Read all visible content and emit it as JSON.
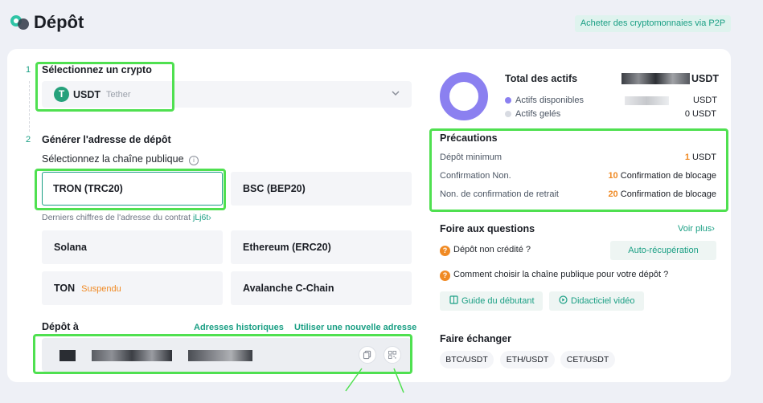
{
  "header": {
    "title": "Dépôt",
    "p2p_button": "Acheter des cryptomonnaies via P2P"
  },
  "step1": {
    "number": "1",
    "title": "Sélectionnez un crypto",
    "selected_symbol": "USDT",
    "selected_name": "Tether",
    "coin_icon": "T"
  },
  "step2": {
    "number": "2",
    "title": "Générer l'adresse de dépôt",
    "chain_label": "Sélectionnez la chaîne publique",
    "info_icon": "i",
    "chains": [
      {
        "name": "TRON (TRC20)",
        "status": ""
      },
      {
        "name": "BSC (BEP20)",
        "status": ""
      },
      {
        "name": "Solana",
        "status": ""
      },
      {
        "name": "Ethereum (ERC20)",
        "status": ""
      },
      {
        "name": "TON",
        "status": "Suspendu"
      },
      {
        "name": "Avalanche C-Chain",
        "status": ""
      }
    ],
    "contract_hint": "Derniers chiffres de l'adresse du contrat",
    "contract_suffix": "jLj6t",
    "contract_arrow": "›"
  },
  "deposit": {
    "title": "Dépôt à",
    "history_link": "Adresses historiques",
    "new_address_link": "Utiliser une nouvelle adresse"
  },
  "assets": {
    "title": "Total des actifs",
    "total_unit": "USDT",
    "available_label": "Actifs disponibles",
    "available_unit": "USDT",
    "frozen_label": "Actifs gelés",
    "frozen_value": "0 USDT",
    "available_color": "#8b80f0",
    "frozen_color": "#d8dbe2"
  },
  "precautions": {
    "title": "Précautions",
    "rows": [
      {
        "label": "Dépôt minimum",
        "num": "1",
        "text": "USDT"
      },
      {
        "label": "Confirmation Non.",
        "num": "10",
        "text": "Confirmation de blocage"
      },
      {
        "label": "Non. de confirmation de retrait",
        "num": "20",
        "text": "Confirmation de blocage"
      }
    ]
  },
  "faq": {
    "title": "Foire aux questions",
    "more": "Voir plus",
    "more_arrow": "›",
    "q_icon": "?",
    "q1": "Dépôt non crédité ?",
    "q1_button": "Auto-récupération",
    "q2": "Comment choisir la chaîne publique pour votre dépôt ?",
    "guide_button": "Guide du débutant",
    "video_button": "Didacticiel vidéo"
  },
  "exchange": {
    "title": "Faire échanger",
    "pairs": [
      "BTC/USDT",
      "ETH/USDT",
      "CET/USDT"
    ]
  },
  "colors": {
    "accent": "#1a9f84",
    "highlight": "#4fe050",
    "warning": "#f08a24"
  }
}
